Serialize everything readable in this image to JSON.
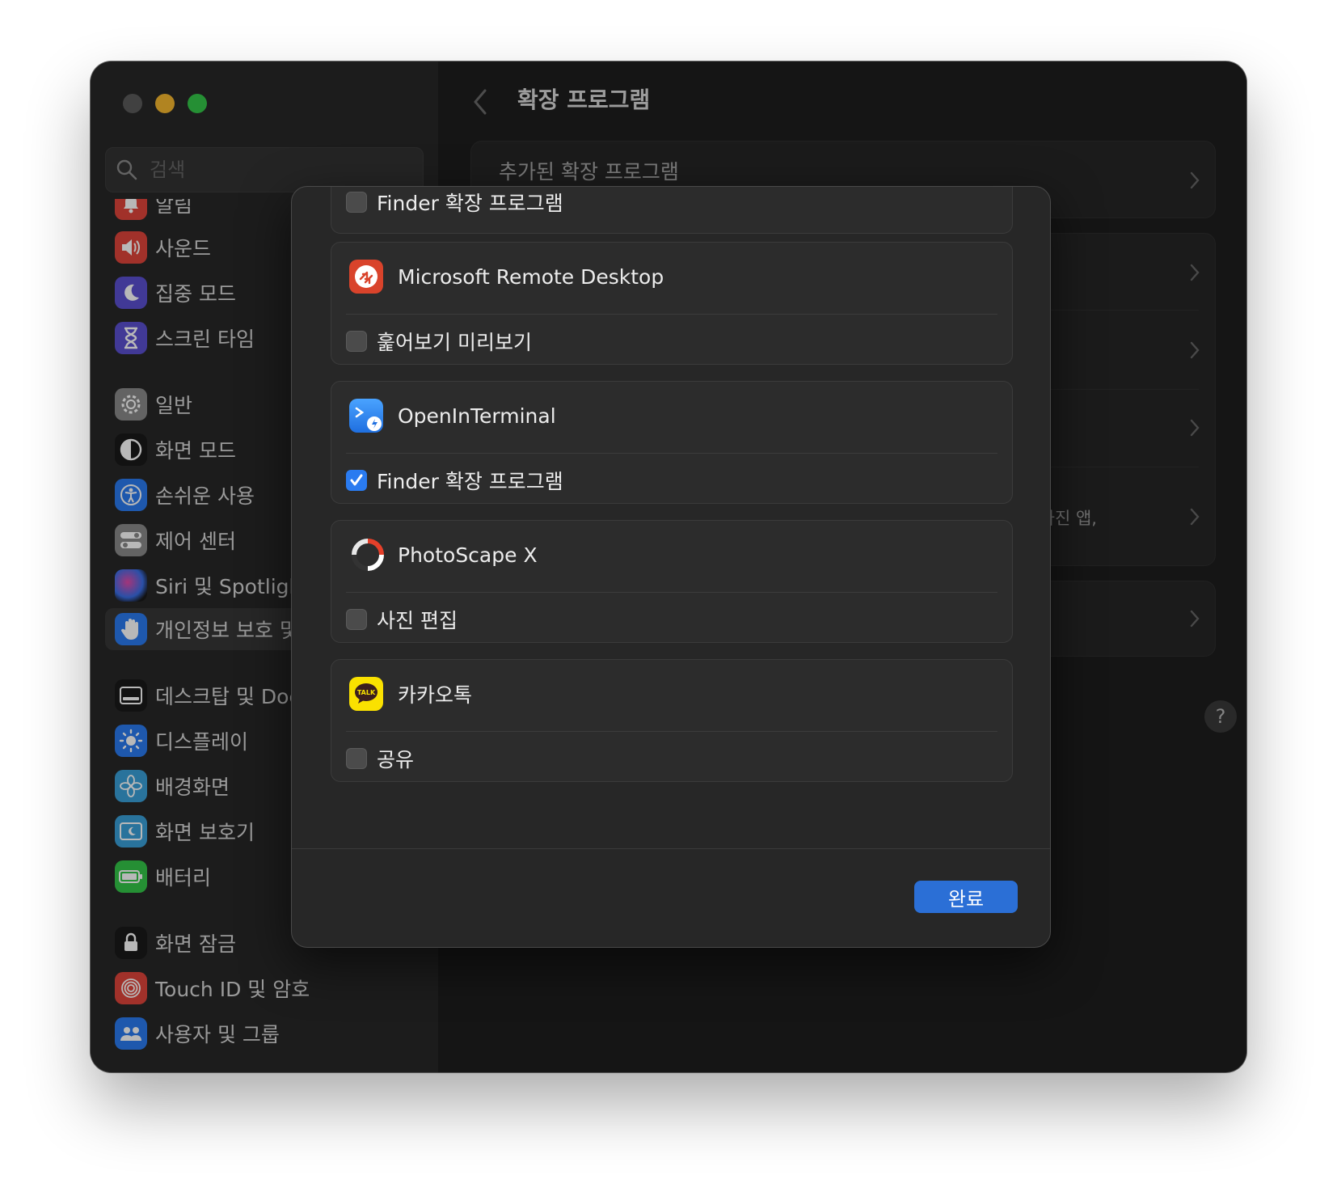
{
  "window": {
    "title": "확장 프로그램"
  },
  "search": {
    "placeholder": "검색"
  },
  "sidebar": {
    "items": [
      {
        "label": "알림",
        "icon": "bell-icon",
        "color": "#e0453b"
      },
      {
        "label": "사운드",
        "icon": "speaker-icon",
        "color": "#e0453b"
      },
      {
        "label": "집중 모드",
        "icon": "moon-icon",
        "color": "#5a4fd0"
      },
      {
        "label": "스크린 타임",
        "icon": "hourglass-icon",
        "color": "#5a4fd0"
      },
      {
        "label": "일반",
        "icon": "gear-icon",
        "color": "#8a8a8a"
      },
      {
        "label": "화면 모드",
        "icon": "appearance-icon",
        "color": "#1a1a1a"
      },
      {
        "label": "손쉬운 사용",
        "icon": "accessibility-icon",
        "color": "#2a7bf0"
      },
      {
        "label": "제어 센터",
        "icon": "control-center-icon",
        "color": "#8a8a8a"
      },
      {
        "label": "Siri 및 Spotlight",
        "icon": "siri-icon",
        "color": "#7b2dbd"
      },
      {
        "label": "개인정보 보호 및 보안",
        "icon": "hand-icon",
        "color": "#2a7bf0"
      },
      {
        "label": "데스크탑 및 Dock",
        "icon": "dock-icon",
        "color": "#1a1a1a"
      },
      {
        "label": "디스플레이",
        "icon": "sun-icon",
        "color": "#2a7bf0"
      },
      {
        "label": "배경화면",
        "icon": "flower-icon",
        "color": "#3aa0d8"
      },
      {
        "label": "화면 보호기",
        "icon": "screensaver-icon",
        "color": "#3aa0d8"
      },
      {
        "label": "배터리",
        "icon": "battery-icon",
        "color": "#34c748"
      },
      {
        "label": "화면 잠금",
        "icon": "lock-icon",
        "color": "#1a1a1a"
      },
      {
        "label": "Touch ID 및 암호",
        "icon": "fingerprint-icon",
        "color": "#e0453b"
      },
      {
        "label": "사용자 및 그룹",
        "icon": "users-icon",
        "color": "#2a7bf0"
      }
    ],
    "selected_index": 9
  },
  "background": {
    "first_card_label": "추가된 확장 프로그램",
    "snippet": "림, 사진 앱,"
  },
  "help_label": "?",
  "sheet": {
    "top_partial_label": "Finder 확장 프로그램",
    "apps": [
      {
        "name": "Microsoft Remote Desktop",
        "icon": "microsoft-remote-desktop-icon",
        "option": "훑어보기 미리보기",
        "checked": false
      },
      {
        "name": "OpenInTerminal",
        "icon": "open-in-terminal-icon",
        "option": "Finder 확장 프로그램",
        "checked": true
      },
      {
        "name": "PhotoScape X",
        "icon": "photoscape-icon",
        "option": "사진 편집",
        "checked": false
      },
      {
        "name": "카카오톡",
        "icon": "kakaotalk-icon",
        "option": "공유",
        "checked": false
      }
    ],
    "done_label": "완료",
    "accent_color": "#2b6fd6"
  }
}
